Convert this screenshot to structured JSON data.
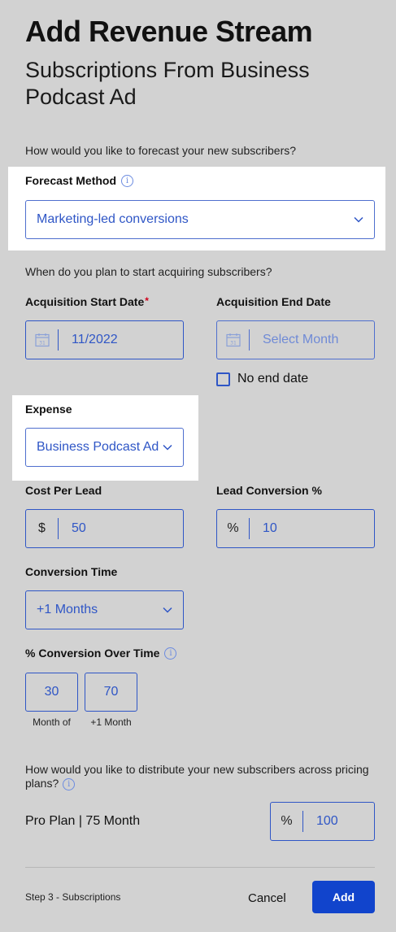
{
  "header": {
    "title": "Add Revenue Stream",
    "subtitle": "Subscriptions From Business Podcast Ad"
  },
  "forecast": {
    "question": "How would you like to forecast your new subscribers?",
    "label": "Forecast Method",
    "value": "Marketing-led conversions"
  },
  "acquisition": {
    "question": "When do you plan to start acquiring subscribers?",
    "start_label": "Acquisition Start Date",
    "required_mark": "*",
    "start_value": "11/2022",
    "end_label": "Acquisition End Date",
    "end_placeholder": "Select Month",
    "no_end_label": "No end date",
    "no_end_checked": false,
    "calendar_day": "31"
  },
  "expense": {
    "label": "Expense",
    "value": "Business Podcast Ad"
  },
  "cost_per_lead": {
    "label": "Cost Per Lead",
    "prefix": "$",
    "value": "50"
  },
  "lead_conversion": {
    "label": "Lead Conversion %",
    "prefix": "%",
    "value": "10"
  },
  "conversion_time": {
    "label": "Conversion Time",
    "value": "+1 Months"
  },
  "conversion_over_time": {
    "label": "% Conversion Over Time",
    "cells": [
      {
        "value": "30",
        "caption": "Month of"
      },
      {
        "value": "70",
        "caption": "+1 Month"
      }
    ]
  },
  "distribution": {
    "question": "How would you like to distribute your new subscribers across pricing plans?",
    "plan_label": "Pro Plan | 75 Month",
    "prefix": "%",
    "value": "100"
  },
  "footer": {
    "step": "Step 3 - Subscriptions",
    "cancel": "Cancel",
    "add": "Add"
  },
  "icons": {
    "info": "info-icon",
    "calendar": "calendar-icon",
    "chevron": "chevron-down-icon"
  },
  "colors": {
    "accent": "#2f56c6",
    "primary_button": "#1144cc",
    "background": "#d2d2d2",
    "required": "#d0021b"
  }
}
